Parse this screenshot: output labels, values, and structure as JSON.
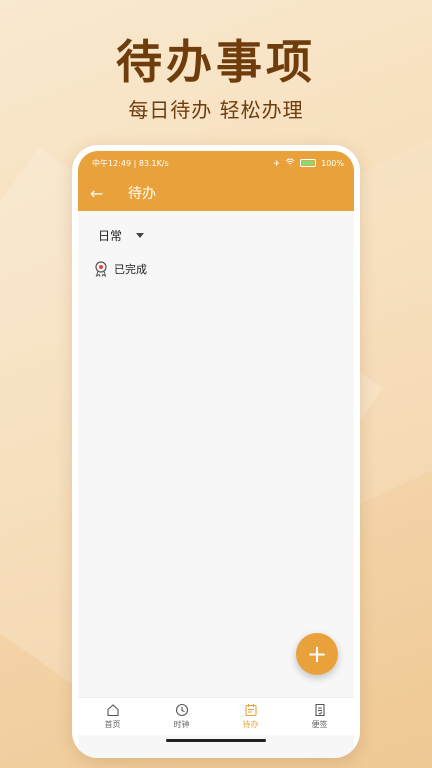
{
  "promo": {
    "title": "待办事项",
    "subtitle": "每日待办 轻松办理"
  },
  "status_bar": {
    "time_speed": "中午12:49 | 83.1K/s",
    "battery": "100%"
  },
  "app_bar": {
    "title": "待办"
  },
  "filter": {
    "selected": "日常"
  },
  "completed": {
    "label": "已完成"
  },
  "fab": {
    "label": "+"
  },
  "bottom_nav": {
    "items": [
      {
        "label": "首页",
        "icon": "home-icon"
      },
      {
        "label": "时钟",
        "icon": "clock-icon"
      },
      {
        "label": "待办",
        "icon": "todo-icon",
        "active": true
      },
      {
        "label": "便签",
        "icon": "note-icon"
      }
    ]
  },
  "colors": {
    "accent": "#e9a23b",
    "promo_text": "#6f3d0c"
  }
}
